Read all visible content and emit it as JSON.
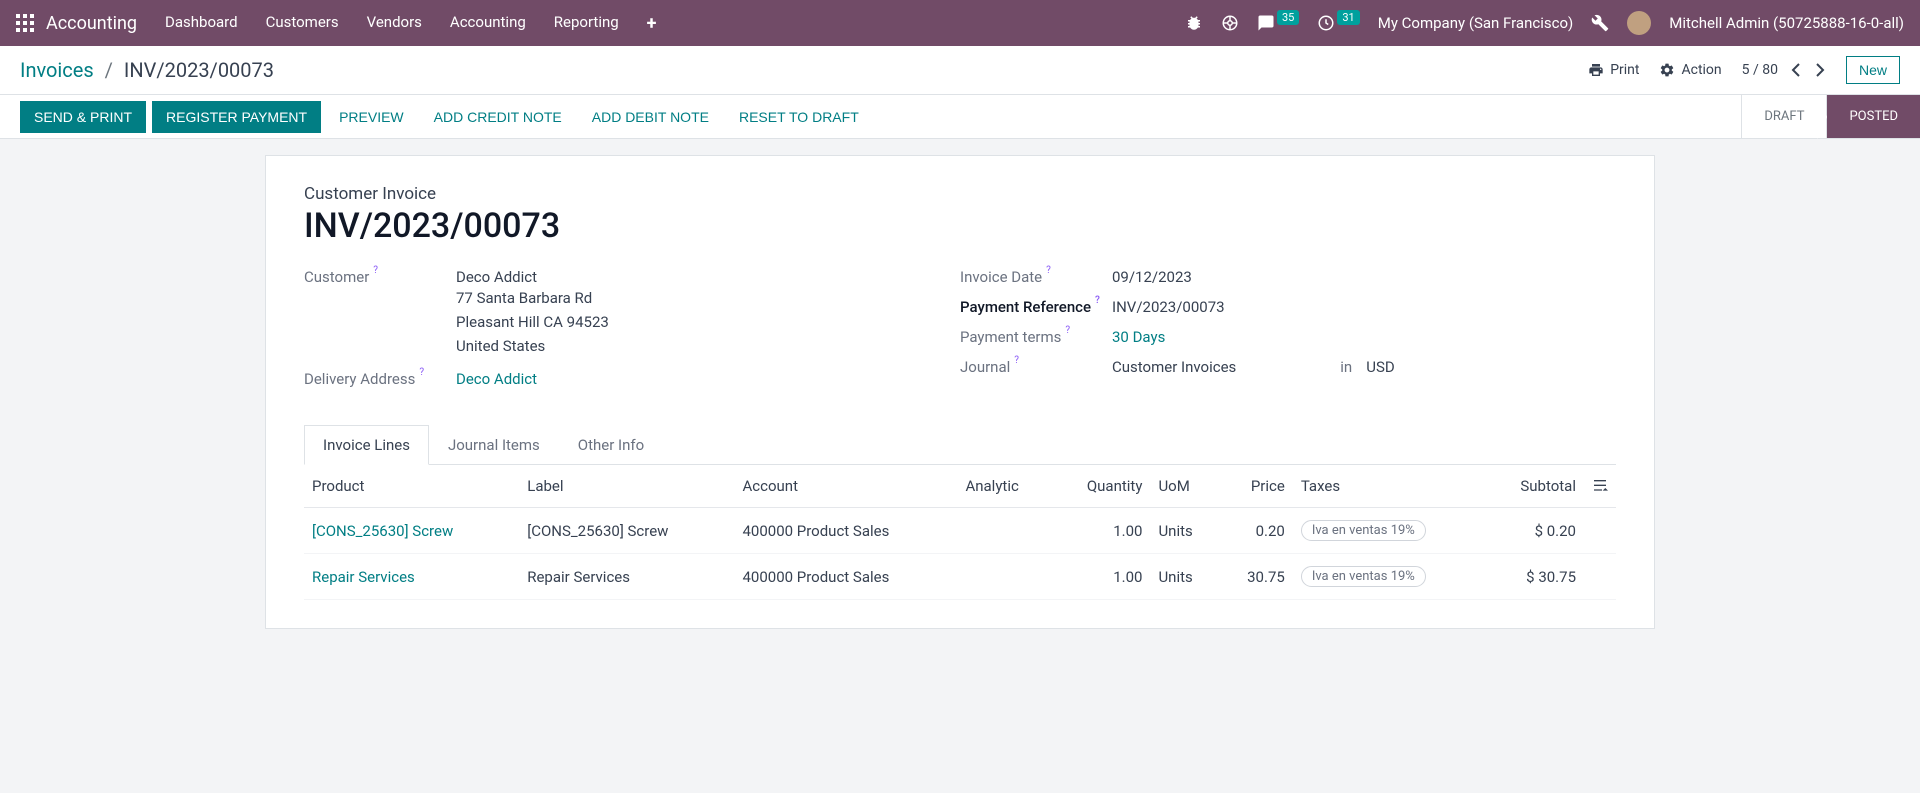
{
  "topnav": {
    "app_name": "Accounting",
    "menu": [
      "Dashboard",
      "Customers",
      "Vendors",
      "Accounting",
      "Reporting"
    ],
    "messaging_count": "35",
    "activity_count": "31",
    "company": "My Company (San Francisco)",
    "username": "Mitchell Admin (50725888-16-0-all)"
  },
  "breadcrumb": {
    "root": "Invoices",
    "current": "INV/2023/00073"
  },
  "cp": {
    "print": "Print",
    "action": "Action",
    "pager": "5 / 80",
    "new": "New"
  },
  "buttons": {
    "send_print": "Send & Print",
    "register_payment": "Register Payment",
    "preview": "Preview",
    "add_credit_note": "Add Credit Note",
    "add_debit_note": "Add Debit Note",
    "reset_draft": "Reset to Draft"
  },
  "status": {
    "draft": "Draft",
    "posted": "Posted"
  },
  "doc": {
    "type": "Customer Invoice",
    "name": "INV/2023/00073"
  },
  "fields": {
    "customer_label": "Customer",
    "customer": "Deco Addict",
    "addr1": "77 Santa Barbara Rd",
    "addr2": "Pleasant Hill CA 94523",
    "addr3": "United States",
    "delivery_label": "Delivery Address",
    "delivery": "Deco Addict",
    "invoice_date_label": "Invoice Date",
    "invoice_date": "09/12/2023",
    "pay_ref_label": "Payment Reference",
    "pay_ref": "INV/2023/00073",
    "terms_label": "Payment terms",
    "terms": "30 Days",
    "journal_label": "Journal",
    "journal": "Customer Invoices",
    "in": "in",
    "currency": "USD"
  },
  "tabs": {
    "lines": "Invoice Lines",
    "journal_items": "Journal Items",
    "other": "Other Info"
  },
  "table": {
    "headers": {
      "product": "Product",
      "label": "Label",
      "account": "Account",
      "analytic": "Analytic",
      "quantity": "Quantity",
      "uom": "UoM",
      "price": "Price",
      "taxes": "Taxes",
      "subtotal": "Subtotal"
    },
    "rows": [
      {
        "product": "[CONS_25630] Screw",
        "label": "[CONS_25630] Screw",
        "account": "400000 Product Sales",
        "analytic": "",
        "quantity": "1.00",
        "uom": "Units",
        "price": "0.20",
        "tax": "Iva en ventas 19%",
        "subtotal": "$ 0.20"
      },
      {
        "product": "Repair Services",
        "label": "Repair Services",
        "account": "400000 Product Sales",
        "analytic": "",
        "quantity": "1.00",
        "uom": "Units",
        "price": "30.75",
        "tax": "Iva en ventas 19%",
        "subtotal": "$ 30.75"
      }
    ]
  }
}
